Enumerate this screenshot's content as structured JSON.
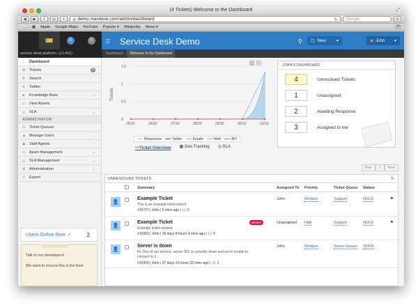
{
  "browser": {
    "window_title": "(4 Tickets) Welcome to the Dashboard",
    "url": "demo.maxdesk.com/admin/dashboard",
    "search_placeholder": "Google",
    "bookmarks": [
      "Apple",
      "Google Maps",
      "YouTube",
      "Popular ▾",
      "Wikipedia",
      "News ▾"
    ]
  },
  "header": {
    "platform": "service desk platform. (v1.411)",
    "app_title": "Service Desk Demo",
    "new_button": "New",
    "user_button": "John",
    "breadcrumb": [
      "Dashboard",
      "Welcome to the Dashboard"
    ],
    "brand_tab_badges": [
      "0",
      "0"
    ]
  },
  "sidebar": {
    "items": [
      {
        "label": "Dashboard",
        "icon": "home-icon"
      },
      {
        "label": "Tickets",
        "icon": "list-icon",
        "badge": "0"
      },
      {
        "label": "Search",
        "icon": "search-icon"
      },
      {
        "label": "Twitter",
        "icon": "twitter-icon"
      },
      {
        "label": "Knowledge Base",
        "icon": "info-icon"
      },
      {
        "label": "View Assets",
        "icon": "monitor-icon"
      },
      {
        "label": "SLA",
        "icon": "bell-icon"
      }
    ],
    "section_admin": "ADMINISTRATION",
    "admin_items": [
      {
        "label": "Ticket Queues",
        "icon": "queue-icon"
      },
      {
        "label": "Manage Users",
        "icon": "user-icon"
      },
      {
        "label": "Staff Agents",
        "icon": "agent-icon"
      },
      {
        "label": "Asset Management",
        "icon": "asset-icon"
      },
      {
        "label": "SLA Management",
        "icon": "bell-icon"
      },
      {
        "label": "Administration",
        "icon": "gear-icon"
      },
      {
        "label": "Export",
        "icon": "export-icon"
      }
    ],
    "users_online_label": "Users Online Now",
    "users_online_count": "2",
    "chat_line1": "Talk to our developers!",
    "chat_line2": "We want to ensure this is the best"
  },
  "chart_data": {
    "type": "line",
    "ylabel": "Tickets",
    "x": [
      "25/10",
      "26/10",
      "27/10",
      "28/10",
      "29/10",
      "30/10",
      "31/10"
    ],
    "yticks": [
      "1.5",
      "1",
      "0.5",
      "0"
    ],
    "ylim": [
      0,
      1.5
    ],
    "series": [
      {
        "name": "Responses",
        "color": "#c8c850",
        "values": [
          0,
          0,
          0,
          0,
          0,
          0,
          0
        ]
      },
      {
        "name": "Twitter",
        "color": "#1f4e8c",
        "values": [
          0,
          0,
          0,
          0,
          0,
          0,
          0
        ]
      },
      {
        "name": "Emails",
        "color": "#e8a038",
        "values": [
          0,
          0,
          0,
          0,
          0,
          0,
          0
        ]
      },
      {
        "name": "Web",
        "color": "#6ab0e0",
        "values": [
          0,
          0,
          0,
          0,
          0,
          0,
          1.3
        ]
      },
      {
        "name": "API",
        "color": "#e05050",
        "values": [
          0,
          0,
          0,
          0,
          0,
          0,
          0
        ]
      }
    ]
  },
  "chart_tabs": [
    "Ticket Overview",
    "Geo Tracking",
    "SLA"
  ],
  "dashboard": {
    "title": "JOHN'S DASHBOARD",
    "stats": [
      {
        "value": "4",
        "label": "Unresolved Tickets",
        "highlight": true
      },
      {
        "value": "1",
        "label": "Unassigned",
        "highlight": false
      },
      {
        "value": "2",
        "label": "Awaiting Response",
        "highlight": false
      },
      {
        "value": "3",
        "label": "Assigned to me",
        "highlight": false
      }
    ]
  },
  "pager": {
    "prev": "Prev",
    "page": "1",
    "next": "Next"
  },
  "tickets": {
    "title": "UNRESOLVED TICKETS",
    "columns": {
      "summary": "Summary",
      "assigned": "Assigned To",
      "priority": "Priority",
      "queue": "Ticket Queue",
      "status": "Status"
    },
    "rows": [
      {
        "subject": "Example Ticket",
        "desc": "This is an example ticket raised",
        "meta": "#10727 | John | 5 mins ago | 🗨 0",
        "assigned": "John",
        "priority": "Medium",
        "queue": "Support",
        "status": "HOLD",
        "breach": ""
      },
      {
        "subject": "Example Ticket",
        "desc": "Example ticket content",
        "meta": "#10903 | John | 28 days 8 hours 4 mins ago | 🗨 0",
        "assigned": "Unassigned",
        "priority": "High",
        "queue": "Support",
        "status": "HOLD",
        "breach": "Breach"
      },
      {
        "subject": "Server is down",
        "desc": "Hi, One of our servers, server 001 is currently down and we're unable to connect to it...",
        "meta": "#10459 | John | 37 days 19 hours 22 mins ago | 🗨 1",
        "assigned": "John",
        "priority": "Medium",
        "queue": "Server Issues",
        "status": "OPEN",
        "breach": ""
      }
    ]
  }
}
